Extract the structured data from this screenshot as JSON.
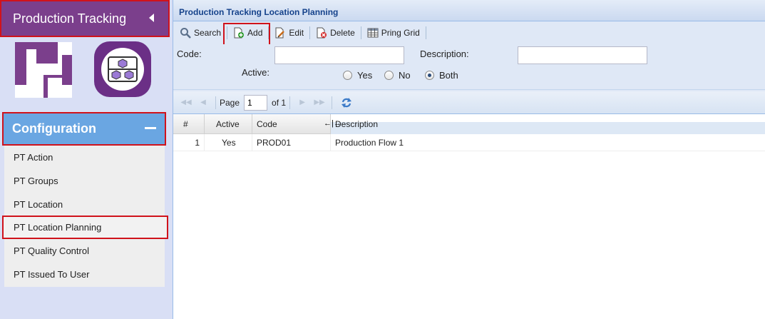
{
  "sidebar": {
    "title": "Production Tracking",
    "config_title": "Configuration",
    "items": [
      {
        "label": "PT Action"
      },
      {
        "label": "PT Groups"
      },
      {
        "label": "PT Location"
      },
      {
        "label": "PT Location Planning",
        "selected": true
      },
      {
        "label": "PT Quality Control"
      },
      {
        "label": "PT Issued To User"
      }
    ]
  },
  "panel": {
    "title": "Production Tracking Location Planning"
  },
  "toolbar": {
    "search": "Search",
    "add": "Add",
    "edit": "Edit",
    "delete": "Delete",
    "print": "Pring Grid"
  },
  "form": {
    "code_label": "Code:",
    "code_value": "",
    "description_label": "Description:",
    "description_value": "",
    "active_label": "Active:",
    "options": [
      "Yes",
      "No",
      "Both"
    ],
    "selected": "Both"
  },
  "pager": {
    "page_label": "Page",
    "page_value": "1",
    "of_label": "of 1"
  },
  "grid": {
    "columns": [
      "#",
      "Active",
      "Code",
      "Description"
    ],
    "rows": [
      {
        "num": "1",
        "active": "Yes",
        "code": "PROD01",
        "description": "Production Flow 1"
      }
    ]
  },
  "colors": {
    "brand_purple": "#7b3f8c",
    "config_blue": "#6aa6e2",
    "highlight_red": "#d0121b",
    "panel_title": "#15428b"
  }
}
